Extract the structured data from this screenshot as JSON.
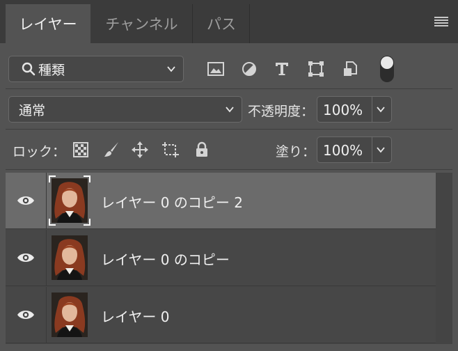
{
  "tabs": [
    {
      "label": "レイヤー",
      "active": true
    },
    {
      "label": "チャンネル",
      "active": false
    },
    {
      "label": "パス",
      "active": false
    }
  ],
  "panel_menu_icon": "hamburger-menu-icon",
  "filter": {
    "kind_label": "種類",
    "icons": [
      "image-filter-icon",
      "adjustment-filter-icon",
      "type-filter-icon",
      "shape-filter-icon",
      "smart-object-filter-icon"
    ]
  },
  "blend": {
    "mode": "通常",
    "opacity_label": "不透明度：",
    "opacity_value": "100%"
  },
  "lock": {
    "label": "ロック：",
    "icons": [
      "lock-transparent-pixels-icon",
      "lock-image-pixels-icon",
      "lock-position-icon",
      "lock-artboard-icon",
      "lock-all-icon"
    ],
    "fill_label": "塗り：",
    "fill_value": "100%"
  },
  "layers": [
    {
      "name": "レイヤー 0 のコピー 2",
      "visible": true,
      "selected": true
    },
    {
      "name": "レイヤー 0 のコピー",
      "visible": true,
      "selected": false
    },
    {
      "name": "レイヤー 0",
      "visible": true,
      "selected": false
    }
  ],
  "colors": {
    "panel_bg": "#535353",
    "tabbar_bg": "#3b3b3b",
    "layer_bg": "#474747",
    "selected_layer_bg": "#6b6b6b"
  }
}
